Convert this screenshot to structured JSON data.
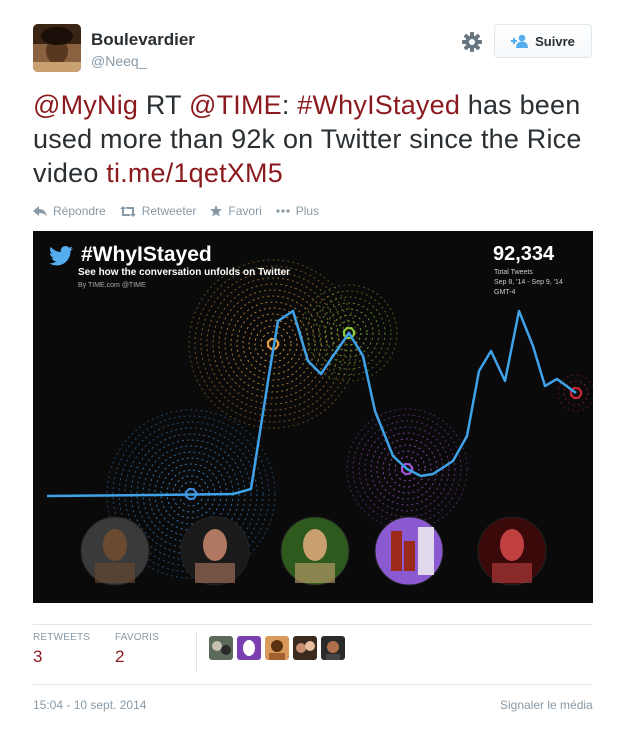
{
  "user": {
    "name": "Boulevardier",
    "handle": "@Neeq_"
  },
  "follow_label": "Suivre",
  "tweet": {
    "parts": [
      "@MyNig",
      " RT ",
      "@TIME",
      ": ",
      "#WhyIStayed",
      " has been used more than 92k on Twitter since the Rice video ",
      "ti.me/1qetXM5"
    ]
  },
  "actions": {
    "reply": "Répondre",
    "retweet": "Retweeter",
    "favorite": "Favori",
    "more": "Plus"
  },
  "media": {
    "title": "#WhyIStayed",
    "subtitle": "See how the conversation unfolds on Twitter",
    "byline": "By TIME.com @TIME",
    "count": "92,334",
    "count_label": "Total Tweets",
    "range": "Sep 8, '14 - Sep 9, '14",
    "timezone": "GMT-4",
    "colors": {
      "line": "#3fa2e8",
      "orange": "#e8a040",
      "green": "#8ccf3a",
      "blue": "#3f8fdc",
      "purple": "#a553d6",
      "red": "#d0283a"
    }
  },
  "stats": {
    "retweets_label": "RETWEETS",
    "retweets": "3",
    "favorites_label": "FAVORIS",
    "favorites": "2"
  },
  "timestamp": "15:04 - 10 sept. 2014",
  "report_label": "Signaler le média"
}
